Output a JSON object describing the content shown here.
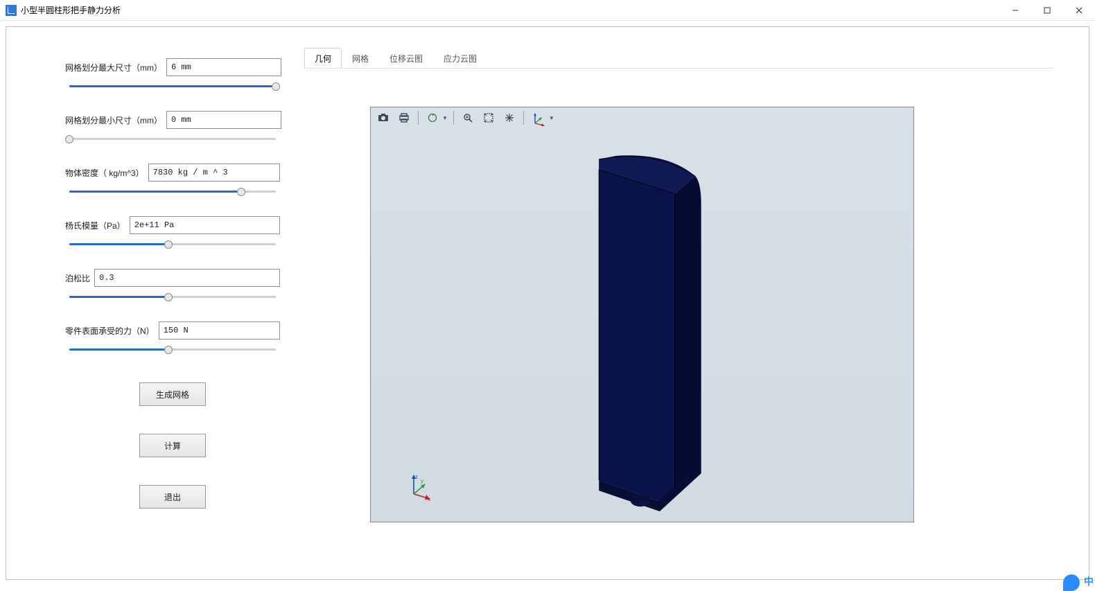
{
  "window": {
    "title": "小型半圆柱形把手静力分析"
  },
  "params": [
    {
      "label": "网格划分最大尺寸（mm）",
      "value": "6 mm",
      "slider_pct": 100
    },
    {
      "label": "网格划分最小尺寸（mm）",
      "value": "0 mm",
      "slider_pct": 0
    },
    {
      "label": "物体密度（ kg/m^3）",
      "value": "7830 kg / m ^ 3",
      "slider_pct": 82
    },
    {
      "label": "杨氏模量（Pa）",
      "value": "2e+11 Pa",
      "slider_pct": 48
    },
    {
      "label": "泊松比",
      "value": "0.3",
      "slider_pct": 48
    },
    {
      "label": "零件表面承受的力（N）",
      "value": "150 N",
      "slider_pct": 48
    }
  ],
  "buttons": {
    "generate_mesh": "生成网格",
    "compute": "计算",
    "exit": "退出"
  },
  "tabs": {
    "geometry": "几何",
    "mesh": "网格",
    "displacement": "位移云图",
    "stress": "应力云图"
  },
  "viewer_tools": {
    "snapshot": "snapshot",
    "print": "print",
    "spin": "spin",
    "zoom_window": "zoom-window",
    "fit_all": "fit-all",
    "orbit": "orbit",
    "axes": "axes"
  },
  "corner_badge": "中"
}
